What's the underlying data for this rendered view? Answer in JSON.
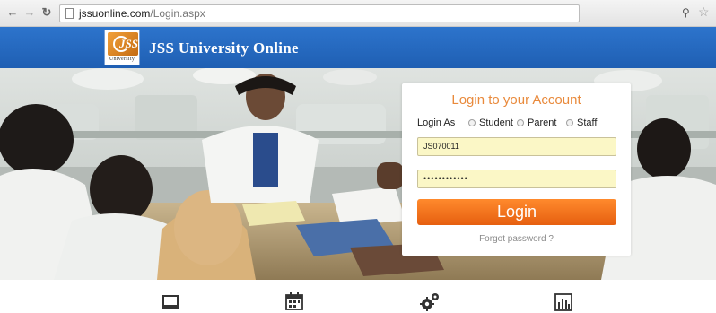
{
  "browser": {
    "url_domain": "jssuonline.com",
    "url_path": "/Login.aspx",
    "back_icon": "arrow-left-icon",
    "forward_icon": "arrow-right-icon",
    "reload_icon": "reload-icon"
  },
  "header": {
    "logo_text": "JSS",
    "logo_subtext": "University",
    "title": "JSS University Online",
    "bg_color": "#2166bd"
  },
  "login": {
    "title": "Login to your Account",
    "login_as_label": "Login As",
    "roles": [
      "Student",
      "Parent",
      "Staff"
    ],
    "username_value": "JS070011",
    "password_value": "••••••••••••",
    "button_label": "Login",
    "forgot_label": "Forgot password ?",
    "accent_color": "#f07a23"
  },
  "bottom_icons": [
    "laptop-icon",
    "calendar-icon",
    "gears-icon",
    "bar-chart-icon"
  ]
}
